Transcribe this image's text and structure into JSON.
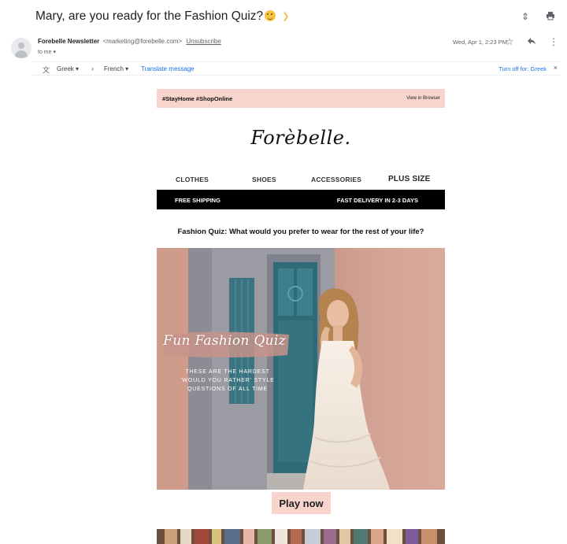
{
  "header": {
    "subject": "Mary, are you ready for the Fashion Quiz?",
    "sender_name": "Forebelle Newsletter",
    "sender_email": "<marketing@forebelle.com>",
    "unsubscribe": "Unsubscribe",
    "to": "to me",
    "date": "Wed, Apr 1, 2:23 PM"
  },
  "translate": {
    "from_lang": "Greek",
    "to_lang": "French",
    "translate_link": "Translate message",
    "turn_off": "Turn off for: Greek"
  },
  "email": {
    "promo_tags": "#StayHome #ShopOnline",
    "view_in_browser": "View in Browser",
    "logo": "Forèbelle.",
    "nav": [
      "CLOTHES",
      "SHOES",
      "ACCESSORIES",
      "PLUS SIZE"
    ],
    "free_shipping": "FREE SHIPPING",
    "fast_delivery": "FAST DELIVERY IN 2-3 DAYS",
    "question": "Fashion Quiz: What would you prefer to wear for the rest of your life?",
    "hero_title": "Fun Fashion Quiz",
    "hero_subtitle": "THESE ARE THE HARDEST 'WOULD YOU RATHER' STYLE QUESTIONS OF ALL TIME",
    "cta": "Play now"
  },
  "colors": {
    "accent_pink": "#f8d4cd",
    "link_blue": "#1a73e8",
    "ship_bar": "#000000"
  }
}
